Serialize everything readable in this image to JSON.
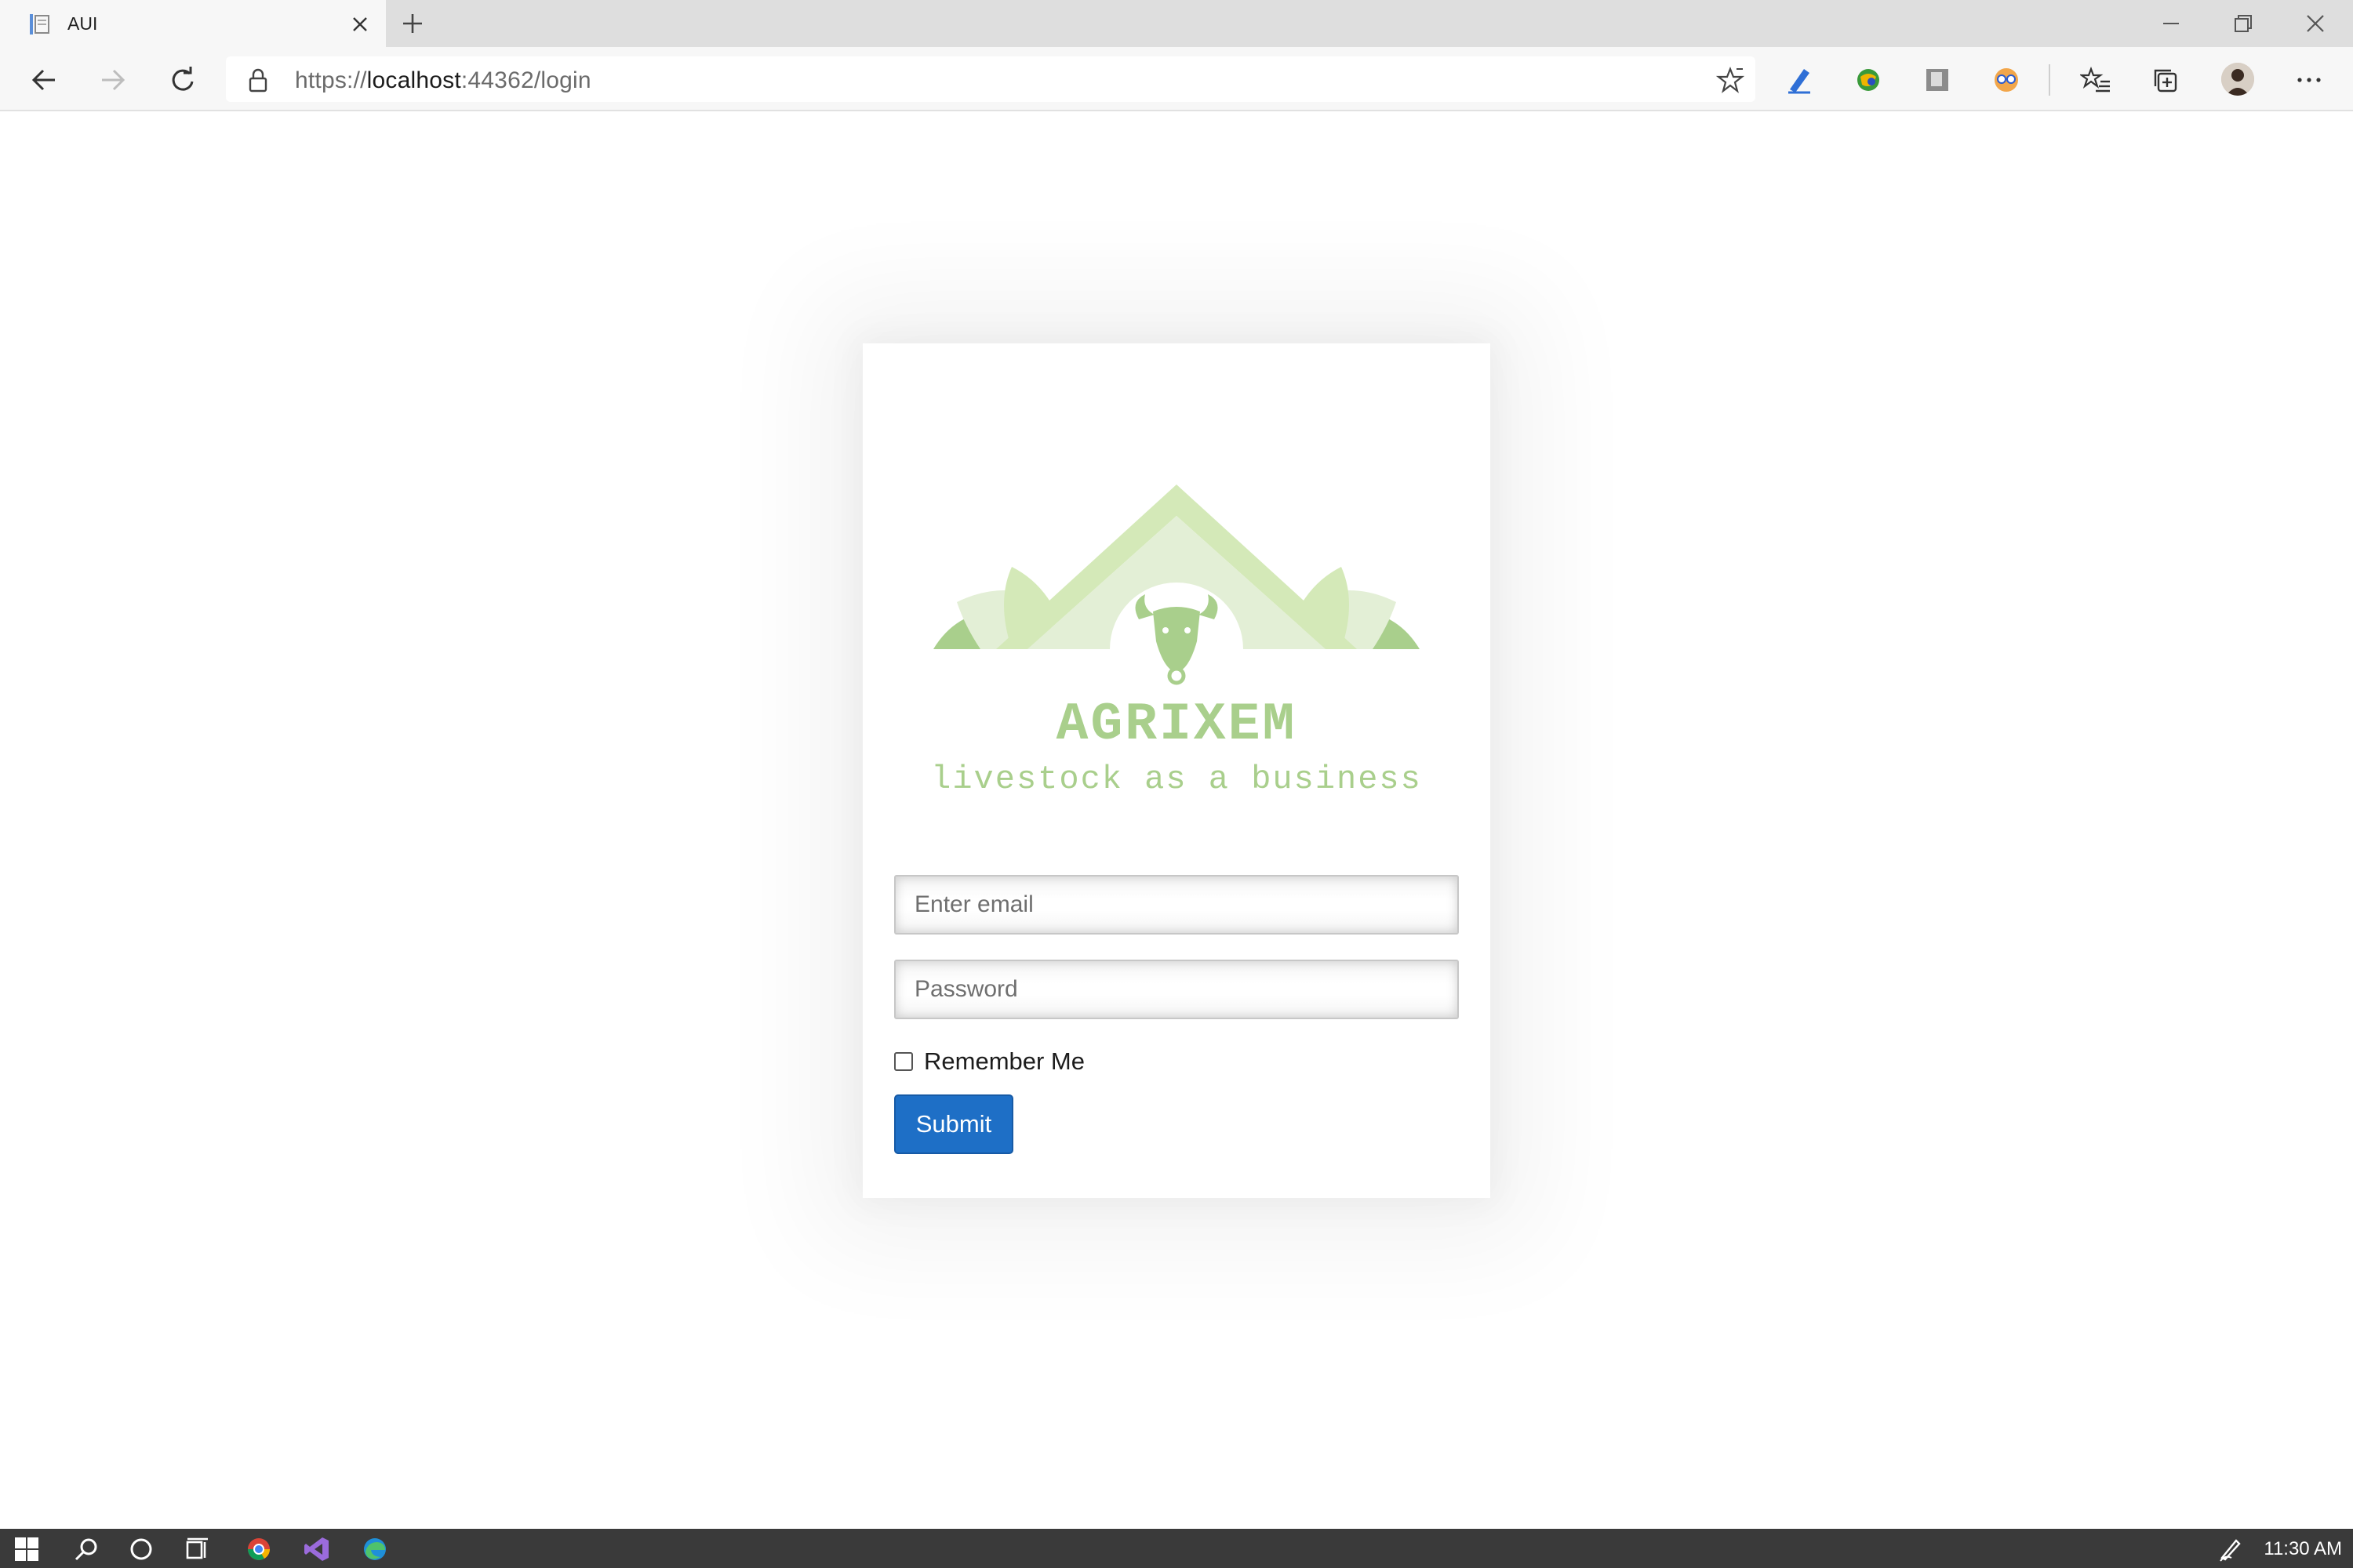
{
  "browser": {
    "tab_title": "AUI",
    "url_prefix": "https://",
    "url_host": "localhost",
    "url_path": ":44362/login",
    "icons": [
      "back-icon",
      "forward-icon",
      "refresh-icon",
      "lock-icon",
      "favorite-star-icon",
      "extension-pen-icon",
      "extension-globe-icon",
      "extension-photo-icon",
      "extension-glasses-icon",
      "favorites-icon",
      "collections-icon",
      "profile-avatar",
      "more-menu-icon"
    ]
  },
  "login": {
    "brand_name": "AGRIXEM",
    "tagline": "livestock as a business",
    "email_placeholder": "Enter email",
    "password_placeholder": "Password",
    "remember_label": "Remember Me",
    "remember_checked": false,
    "submit_label": "Submit",
    "colors": {
      "brand_green": "#a9cf8c",
      "button_blue": "#1e6fc6"
    }
  },
  "taskbar": {
    "clock": "11:30 AM",
    "icons": [
      "windows-start-icon",
      "search-icon",
      "cortana-icon",
      "task-view-icon",
      "chrome-icon",
      "visual-studio-icon",
      "edge-icon",
      "pen-tray-icon"
    ]
  }
}
